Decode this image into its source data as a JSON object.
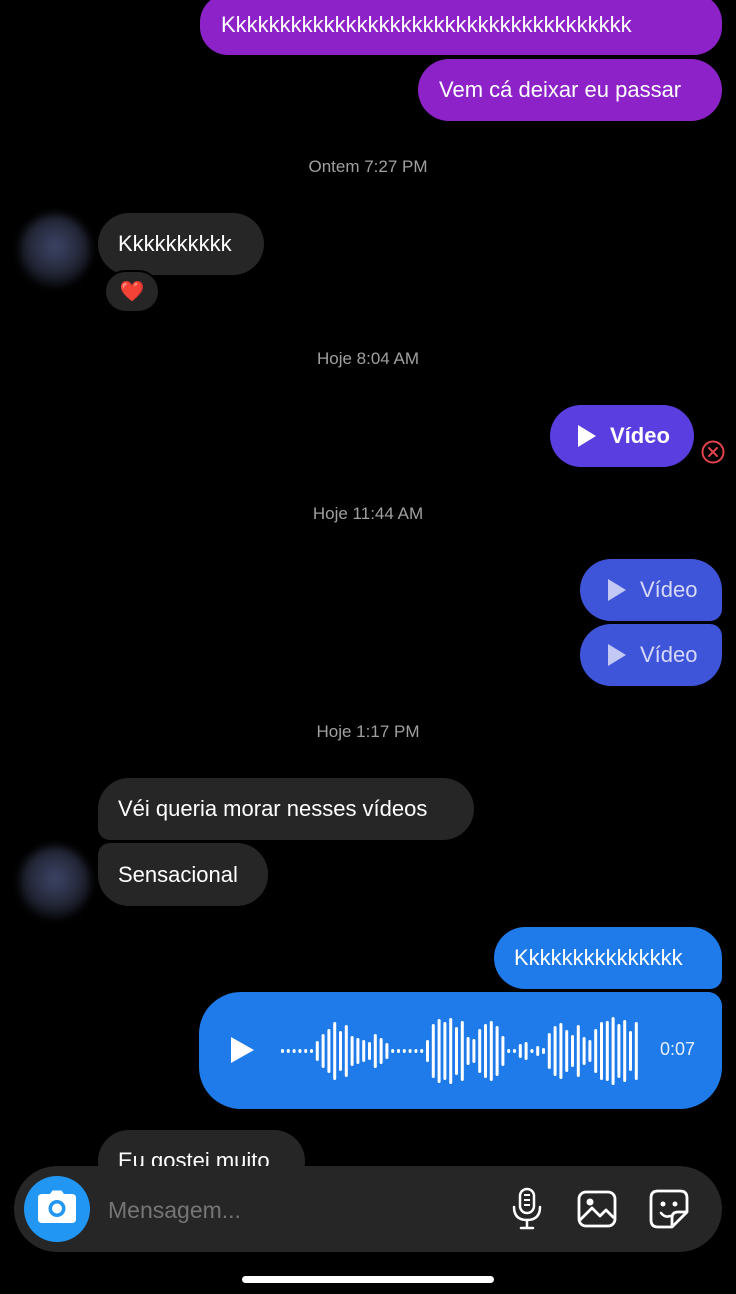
{
  "messages": {
    "m1": "Kkkkkkkkkkkkkkkkkkkkkkkkkkkkkkkkkkkkk",
    "m2": "Vem cá deixar eu passar",
    "t1": "Ontem 7:27 PM",
    "m3": "Kkkkkkkkkk",
    "reaction": "❤️",
    "t2": "Hoje 8:04 AM",
    "video1": "Vídeo",
    "t3": "Hoje 11:44 AM",
    "video2": "Vídeo",
    "video3": "Vídeo",
    "t4": "Hoje 1:17 PM",
    "m4": "Véi queria morar nesses vídeos",
    "m5": "Sensacional",
    "m6": "Kkkkkkkkkkkkkkk",
    "voice_duration": "0:07",
    "m7": "Eu gostei muito"
  },
  "composer": {
    "placeholder": "Mensagem..."
  },
  "icons": {
    "camera": "camera-icon",
    "mic": "microphone-icon",
    "gallery": "image-icon",
    "sticker": "sticker-icon",
    "failed": "failed-send-icon"
  },
  "colors": {
    "sent_purple": "#8d22c9",
    "sent_indigo": "#5a3ee0",
    "sent_blue": "#3f55d9",
    "sent_bright": "#1f7bea",
    "received": "#262626",
    "camera_button": "#2196f3",
    "error": "#e0434a"
  }
}
